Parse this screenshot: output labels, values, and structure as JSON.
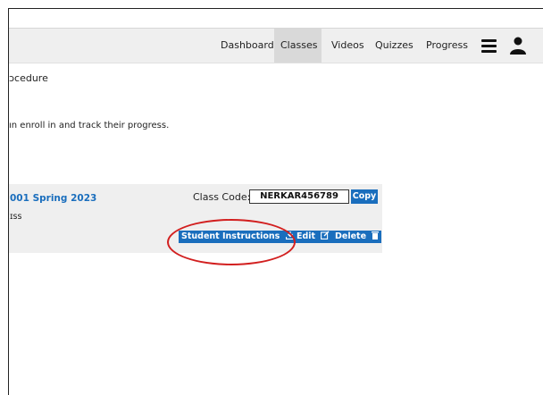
{
  "nav": {
    "items": [
      "Dashboard",
      "Classes",
      "Videos",
      "Quizzes",
      "Progress"
    ],
    "active": "Classes",
    "menu_icon": "hamburger-icon",
    "user_icon": "user-icon"
  },
  "main": {
    "line1": "ɔcedure",
    "line2": "ın enroll in and track their progress."
  },
  "class_card": {
    "title": "001 Spring 2023",
    "subtitle": "ɪss",
    "code_label": "Class Code:",
    "code_value": "NERKAR456789",
    "copy_label": "Copy",
    "student_instructions_label": "Student Instructions",
    "edit_label": "Edit",
    "delete_label": "Delete"
  },
  "colors": {
    "accent": "#1a6ebd",
    "highlight": "#d21f1f"
  }
}
